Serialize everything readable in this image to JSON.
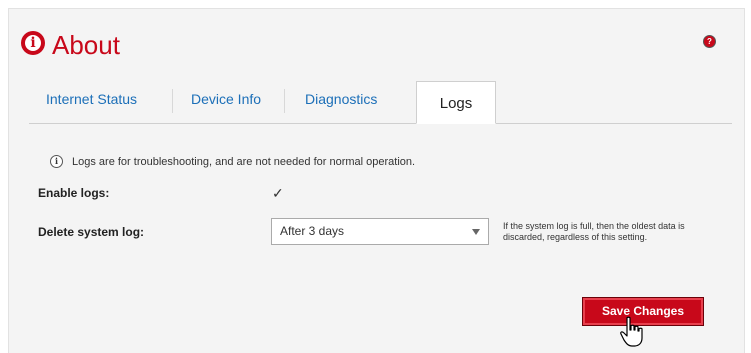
{
  "page": {
    "title": "About",
    "help_icon": "help-icon",
    "title_icon": "info-icon"
  },
  "tabs": [
    {
      "label": "Internet Status",
      "active": false
    },
    {
      "label": "Device Info",
      "active": false
    },
    {
      "label": "Diagnostics",
      "active": false
    },
    {
      "label": "Logs",
      "active": true
    }
  ],
  "info": {
    "text": "Logs are for troubleshooting, and are not needed for normal operation."
  },
  "form": {
    "enable_logs_label": "Enable logs:",
    "enable_logs_checked": true,
    "delete_log_label": "Delete system log:",
    "delete_log_value": "After 3 days",
    "delete_log_hint": "If the system log is full, then the oldest data is discarded, regardless of this setting."
  },
  "actions": {
    "save_label": "Save Changes"
  },
  "colors": {
    "accent": "#c8081a",
    "tab_link": "#1c6fb8",
    "panel_bg": "#f4f4f4"
  }
}
